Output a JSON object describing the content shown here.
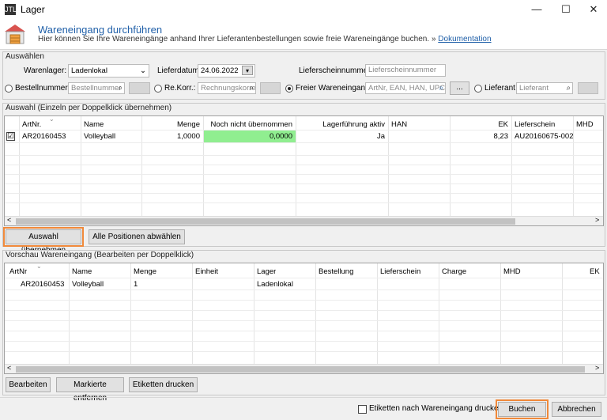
{
  "window": {
    "app_icon_text": "JTL",
    "title": "Lager",
    "minimize": "—",
    "maximize": "☐",
    "close": "✕"
  },
  "header": {
    "title": "Wareneingang durchführen",
    "subtitle": "Hier können Sie Ihre Wareneingänge anhand Ihrer Lieferantenbestellungen sowie freie Wareneingänge buchen.",
    "link_prefix": "»",
    "link": "Dokumentation"
  },
  "select_group": {
    "title": "Auswählen",
    "warenlager_label": "Warenlager:",
    "warenlager_value": "Ladenlokal",
    "lieferdatum_label": "Lieferdatum:",
    "lieferdatum_value": "24.06.2022",
    "lieferschein_label": "Lieferscheinnummer:",
    "lieferschein_placeholder": "Lieferscheinnummer",
    "bestellnummer_label": "Bestellnummer:",
    "bestellnummer_placeholder": "Bestellnummer",
    "rekorr_label": "Re.Korr.:",
    "rekorr_placeholder": "Rechnungskorre",
    "freier_label": "Freier Wareneingang:",
    "freier_placeholder": "ArtNr, EAN, HAN, UPC,",
    "freier_btn": "...",
    "lieferant_label": "Lieferant",
    "lieferant_placeholder": "Lieferant",
    "selected_radio": "freier"
  },
  "auswahl": {
    "title": "Auswahl (Einzeln per Doppelklick übernehmen)",
    "columns": [
      "ArtNr.",
      "Name",
      "Menge",
      "Noch nicht übernommen",
      "Lagerführung aktiv",
      "HAN",
      "EK",
      "Lieferschein",
      "MHD"
    ],
    "rows": [
      {
        "checked": "☑",
        "artnr": "AR20160453",
        "name": "Volleyball",
        "menge": "1,0000",
        "noch": "0,0000",
        "lager_aktiv": "Ja",
        "han": "",
        "ek": "8,23",
        "lieferschein": "AU20160675-002",
        "mhd": ""
      }
    ],
    "btn_uebernehmen": "Auswahl übernehmen",
    "btn_abwaehlen": "Alle Positionen abwählen",
    "noch_color": "#90ee90"
  },
  "vorschau": {
    "title": "Vorschau Wareneingang (Bearbeiten per Doppelklick)",
    "columns": [
      "ArtNr",
      "Name",
      "Menge",
      "Einheit",
      "Lager",
      "Bestellung",
      "Lieferschein",
      "Charge",
      "MHD",
      "EK"
    ],
    "rows": [
      {
        "artnr": "AR20160453",
        "name": "Volleyball",
        "menge": "1",
        "einheit": "",
        "lager": "Ladenlokal"
      }
    ],
    "btn_bearbeiten": "Bearbeiten",
    "btn_entfernen": "Markierte entfernen",
    "btn_etiketten": "Etiketten drucken"
  },
  "footer": {
    "etiketten_checkbox": "Etiketten nach Wareneingang drucken",
    "btn_buchen": "Buchen",
    "btn_abbrechen": "Abbrechen"
  },
  "scroll": {
    "left": "<",
    "right": ">"
  },
  "colors": {
    "accent": "#1f5fa8",
    "highlight": "#f0893a",
    "green_cell": "#90ee90"
  }
}
